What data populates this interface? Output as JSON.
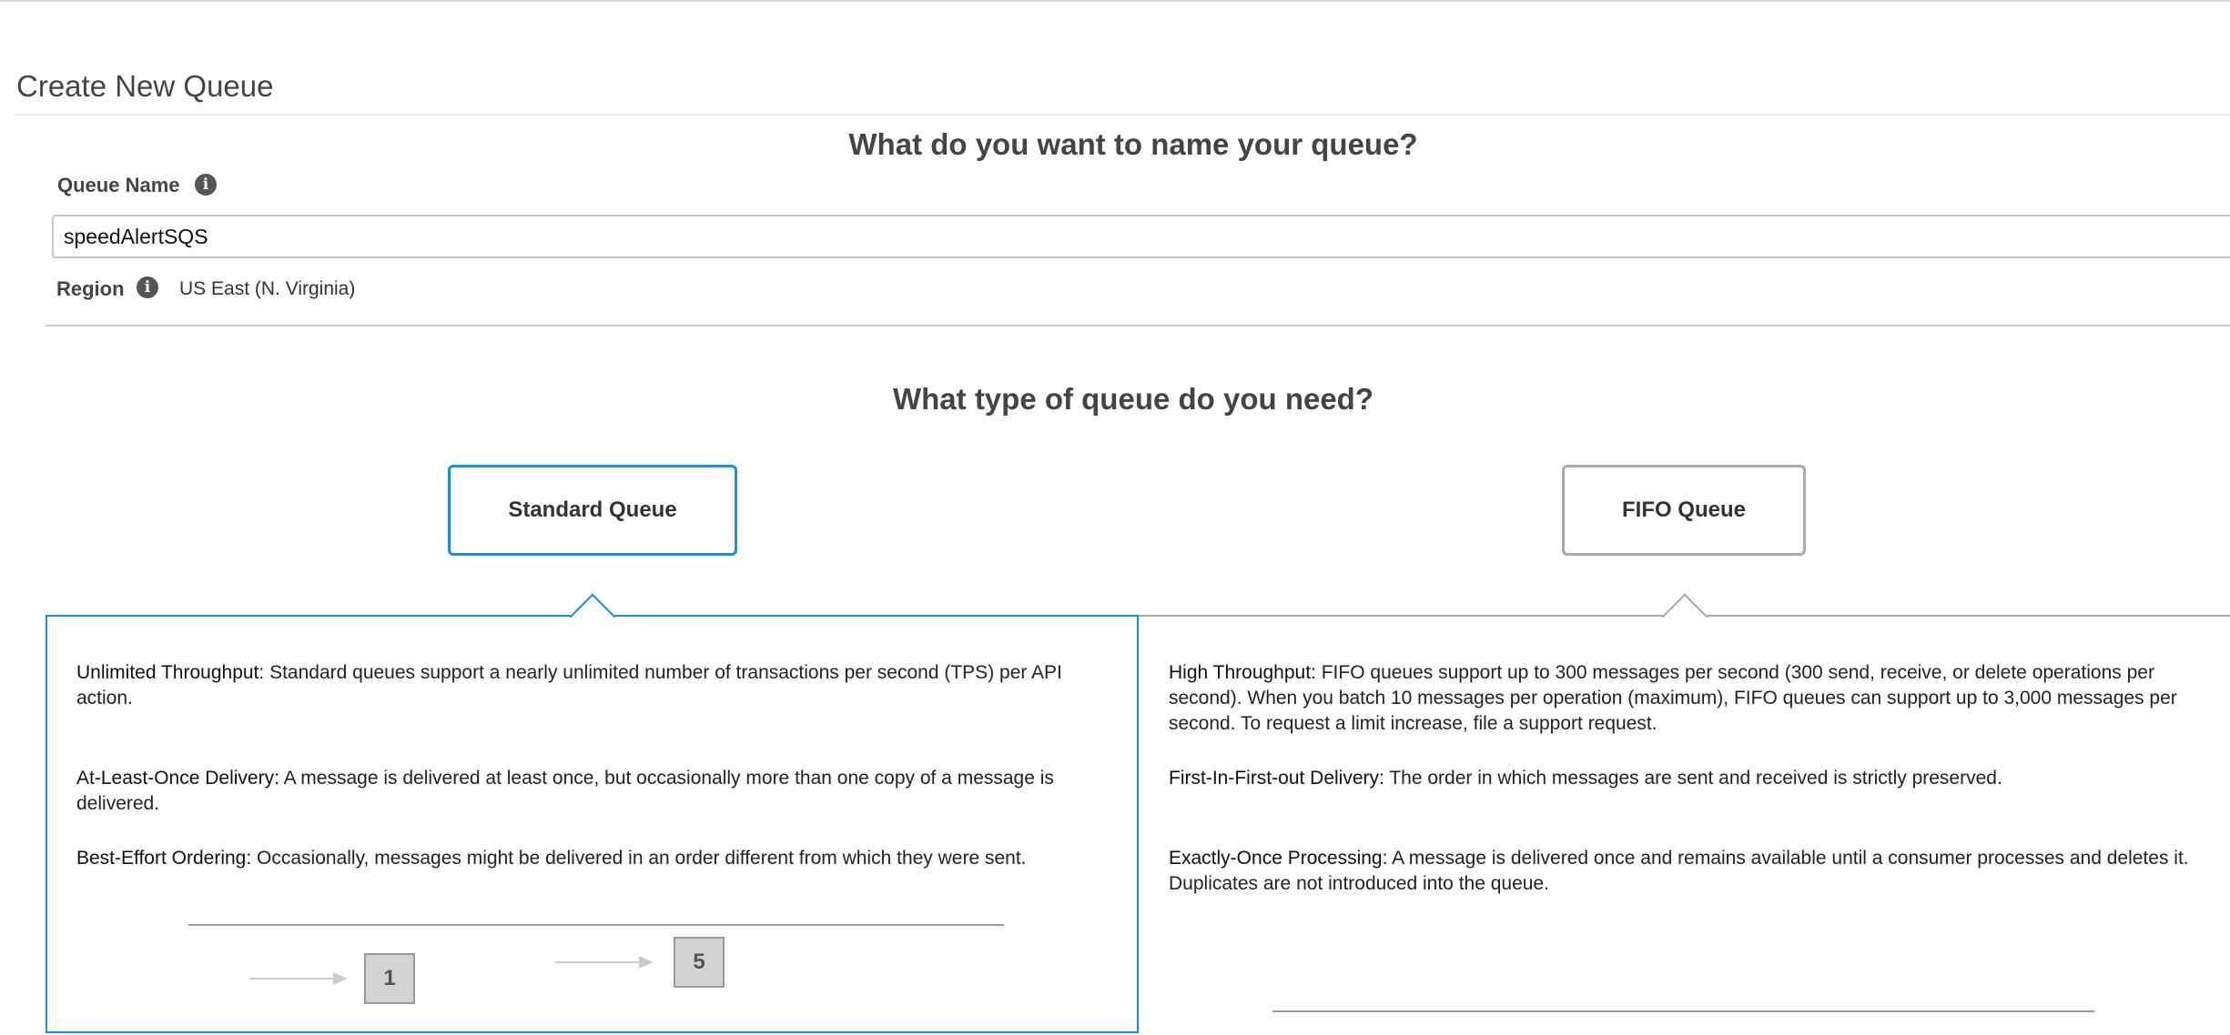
{
  "page": {
    "title": "Create New Queue"
  },
  "name_section": {
    "heading": "What do you want to name your queue?",
    "queue_name_label": "Queue Name",
    "queue_name_value": "speedAlertSQS",
    "region_label": "Region",
    "region_value": "US East (N. Virginia)",
    "info_glyph": "i"
  },
  "type_section": {
    "heading": "What type of queue do you need?",
    "selected": "Standard Queue",
    "options": [
      {
        "label": "Standard Queue",
        "features": [
          {
            "title": "Unlimited Throughput:",
            "text": "Standard queues support a nearly unlimited number of transactions per second (TPS) per API action."
          },
          {
            "title": "At-Least-Once Delivery:",
            "text": "A message is delivered at least once, but occasionally more than one copy of a message is delivered."
          },
          {
            "title": "Best-Effort Ordering:",
            "text": "Occasionally, messages might be delivered in an order different from which they were sent."
          }
        ],
        "diagram_boxes": [
          "1",
          "5"
        ]
      },
      {
        "label": "FIFO Queue",
        "features": [
          {
            "title": "High Throughput:",
            "text": "FIFO queues support up to 300 messages per second (300 send, receive, or delete operations per second). When you batch 10 messages per operation (maximum), FIFO queues can support up to 3,000 messages per second. To request a limit increase, file a support request."
          },
          {
            "title": "First-In-First-out Delivery:",
            "text": "The order in which messages are sent and received is strictly preserved."
          },
          {
            "title": "Exactly-Once Processing:",
            "text": "A message is delivered once and remains available until a consumer processes and deletes it. Duplicates are not introduced into the queue."
          }
        ]
      }
    ]
  },
  "icons": {
    "info": "info-circle-icon",
    "arrow": "arrow-right-icon"
  },
  "colors": {
    "selected_border": "#1a8fdd",
    "unselected_border": "#aaaaaa",
    "text": "#333333"
  }
}
